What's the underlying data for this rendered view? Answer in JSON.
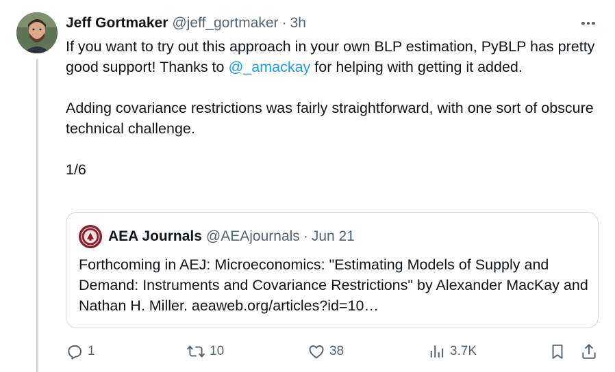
{
  "tweet": {
    "author_name": "Jeff Gortmaker",
    "author_handle": "@jeff_gortmaker",
    "separator": "·",
    "time": "3h",
    "text_line1_before": "If you want to try out this approach in your own BLP estimation, PyBLP has pretty good support! Thanks to ",
    "mention": "@_amackay",
    "text_line1_after": " for helping with getting it added.",
    "text_para2": "Adding covariance restrictions was fairly straightforward, with one sort of obscure technical challenge.",
    "text_para3": "1/6"
  },
  "quoted": {
    "author_name": "AEA Journals",
    "author_handle": "@AEAjournals",
    "separator": "·",
    "date": "Jun 21",
    "text": "Forthcoming in AEJ: Microeconomics: \"Estimating Models of Supply and Demand: Instruments and Covariance Restrictions\" by Alexander MacKay and Nathan H. Miller. aeaweb.org/articles?id=10…"
  },
  "actions": {
    "replies": "1",
    "retweets": "10",
    "likes": "38",
    "views": "3.7K"
  },
  "colors": {
    "text": "#0f1419",
    "secondary": "#536471",
    "link": "#1d9bf0",
    "border": "#cfd9de"
  }
}
